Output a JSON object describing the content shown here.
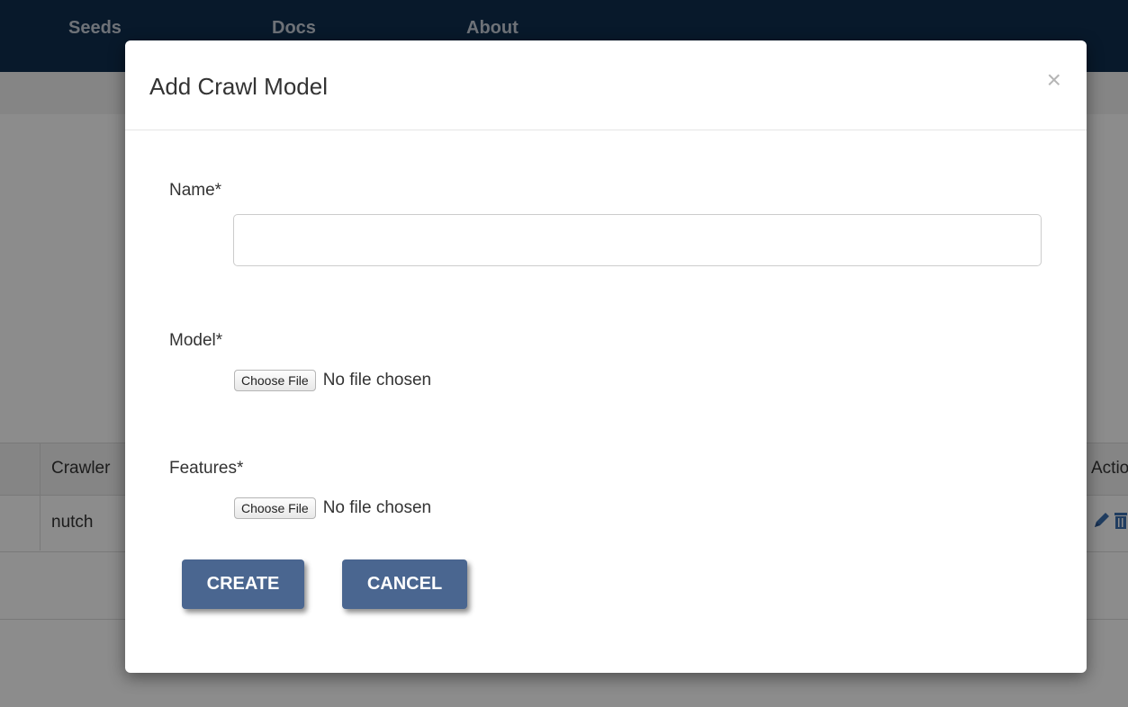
{
  "nav": {
    "items": [
      "Seeds",
      "Docs",
      "About"
    ]
  },
  "background_table": {
    "headers": {
      "crawler": "Crawler",
      "actions": "Actions"
    },
    "rows": [
      {
        "crawler": "nutch"
      }
    ],
    "row_icons": [
      "pencil-icon",
      "trash-icon"
    ]
  },
  "modal": {
    "title": "Add Crawl Model",
    "close_glyph": "×",
    "name_label": "Name*",
    "name_value": "",
    "model_label": "Model*",
    "features_label": "Features*",
    "choose_file_label": "Choose File",
    "no_file_text": "No file chosen",
    "create_label": "CREATE",
    "cancel_label": "CANCEL"
  },
  "colors": {
    "navbar": "#102e4f",
    "button": "#4a6690",
    "action_icon": "#3b6fb0"
  }
}
